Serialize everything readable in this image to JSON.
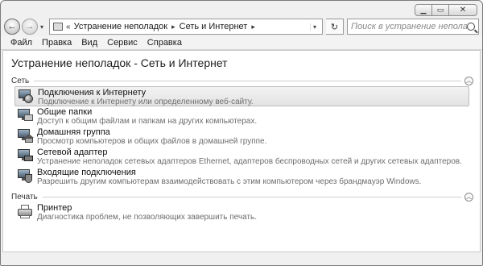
{
  "nav": {
    "back_glyph": "←",
    "forward_glyph": "→",
    "breadcrumb_prefix": "«",
    "breadcrumbs": [
      "Устранение неполадок",
      "Сеть и Интернет"
    ],
    "crumb_arrow": "▸",
    "search_placeholder": "Поиск в устранение неполадок"
  },
  "menu": [
    "Файл",
    "Правка",
    "Вид",
    "Сервис",
    "Справка"
  ],
  "page_title": "Устранение неполадок - Сеть и Интернет",
  "sections": [
    {
      "label": "Сеть",
      "items": [
        {
          "title": "Подключения к Интернету",
          "desc": "Подключение к Интернету или определенному веб-сайту.",
          "icon": "internet-connections-icon"
        },
        {
          "title": "Общие папки",
          "desc": "Доступ к общим файлам и папкам на других компьютерах.",
          "icon": "shared-folders-icon"
        },
        {
          "title": "Домашняя группа",
          "desc": "Просмотр компьютеров и общих файлов в домашней группе.",
          "icon": "homegroup-icon"
        },
        {
          "title": "Сетевой адаптер",
          "desc": "Устранение неполадок сетевых адаптеров Ethernet, адаптеров беспроводных сетей и других сетевых адаптеров.",
          "icon": "network-adapter-icon"
        },
        {
          "title": "Входящие подключения",
          "desc": "Разрешить другим компьютерам взаимодействовать с этим компьютером через брандмауэр Windows.",
          "icon": "incoming-connections-icon"
        }
      ]
    },
    {
      "label": "Печать",
      "items": [
        {
          "title": "Принтер",
          "desc": "Диагностика проблем, не позволяющих завершить печать.",
          "icon": "printer-icon"
        }
      ]
    }
  ],
  "colors": {
    "window_frame": "#f0f0f0",
    "content_bg": "#ffffff",
    "selected_row": "#e6e6e6",
    "desc_text": "#6d6d6d"
  }
}
